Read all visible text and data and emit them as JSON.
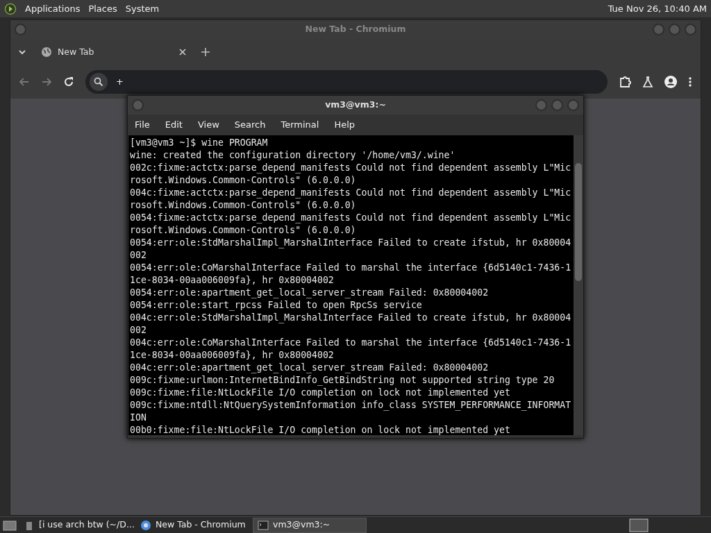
{
  "top_panel": {
    "menus": [
      "Applications",
      "Places",
      "System"
    ],
    "clock": "Tue Nov 26, 10:40 AM"
  },
  "browser": {
    "title": "New Tab - Chromium",
    "tabs": [
      {
        "label": "New Tab",
        "selected": true
      }
    ],
    "address": {
      "value": "+"
    }
  },
  "terminal": {
    "title": "vm3@vm3:~",
    "menus": [
      "File",
      "Edit",
      "View",
      "Search",
      "Terminal",
      "Help"
    ],
    "lines": [
      "[vm3@vm3 ~]$ wine PROGRAM",
      "wine: created the configuration directory '/home/vm3/.wine'",
      "002c:fixme:actctx:parse_depend_manifests Could not find dependent assembly L\"Mic",
      "rosoft.Windows.Common-Controls\" (6.0.0.0)",
      "004c:fixme:actctx:parse_depend_manifests Could not find dependent assembly L\"Mic",
      "rosoft.Windows.Common-Controls\" (6.0.0.0)",
      "0054:fixme:actctx:parse_depend_manifests Could not find dependent assembly L\"Mic",
      "rosoft.Windows.Common-Controls\" (6.0.0.0)",
      "0054:err:ole:StdMarshalImpl_MarshalInterface Failed to create ifstub, hr 0x80004",
      "002",
      "0054:err:ole:CoMarshalInterface Failed to marshal the interface {6d5140c1-7436-1",
      "1ce-8034-00aa006009fa}, hr 0x80004002",
      "0054:err:ole:apartment_get_local_server_stream Failed: 0x80004002",
      "0054:err:ole:start_rpcss Failed to open RpcSs service",
      "004c:err:ole:StdMarshalImpl_MarshalInterface Failed to create ifstub, hr 0x80004",
      "002",
      "004c:err:ole:CoMarshalInterface Failed to marshal the interface {6d5140c1-7436-1",
      "1ce-8034-00aa006009fa}, hr 0x80004002",
      "004c:err:ole:apartment_get_local_server_stream Failed: 0x80004002",
      "009c:fixme:urlmon:InternetBindInfo_GetBindString not supported string type 20",
      "009c:fixme:file:NtLockFile I/O completion on lock not implemented yet",
      "009c:fixme:ntdll:NtQuerySystemInformation info_class SYSTEM_PERFORMANCE_INFORMAT",
      "ION",
      "00b0:fixme:file:NtLockFile I/O completion on lock not implemented yet"
    ]
  },
  "taskbar": {
    "items": [
      {
        "kind": "files",
        "label": "[i use arch btw (~/D...",
        "selected": false
      },
      {
        "kind": "browser",
        "label": "New Tab - Chromium",
        "selected": false
      },
      {
        "kind": "terminal",
        "label": "vm3@vm3:~",
        "selected": true
      }
    ]
  }
}
